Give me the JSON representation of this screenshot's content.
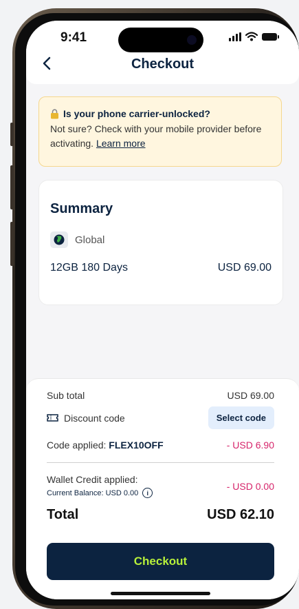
{
  "status": {
    "time": "9:41"
  },
  "header": {
    "title": "Checkout"
  },
  "alert": {
    "title": "Is your phone carrier-unlocked?",
    "body": "Not sure? Check with your mobile provider before activating.",
    "link": "Learn more"
  },
  "summary": {
    "title": "Summary",
    "region": "Global",
    "plan": "12GB 180 Days",
    "price": "USD 69.00"
  },
  "checkout": {
    "subtotal_label": "Sub total",
    "subtotal_value": "USD 69.00",
    "discount_label": "Discount code",
    "select_code_label": "Select code",
    "code_applied_label": "Code applied:",
    "code": "FLEX10OFF",
    "code_discount": "- USD 6.90",
    "wallet_label": "Wallet Credit applied:",
    "balance_label": "Current Balance: USD 0.00",
    "wallet_value": "- USD 0.00",
    "total_label": "Total",
    "total_value": "USD 62.10",
    "button_label": "Checkout"
  },
  "colors": {
    "brand_navy": "#0c2340",
    "accent_lime": "#b7f03a",
    "negative": "#d6246a",
    "alert_bg": "#fff6df"
  }
}
